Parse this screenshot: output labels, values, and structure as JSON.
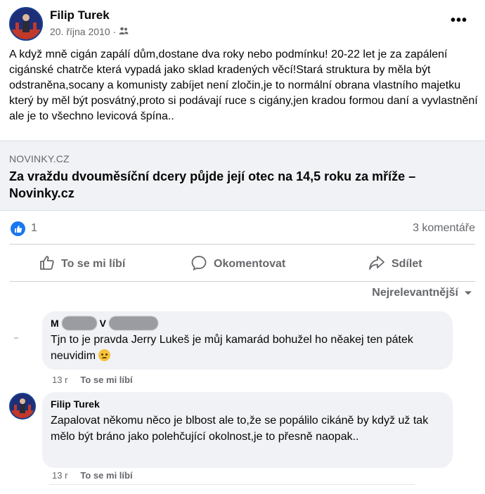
{
  "post": {
    "author": "Filip Turek",
    "date": "20. října 2010",
    "separator": "·",
    "audience_icon": "friends-icon",
    "more_icon": "more-options-icon",
    "more_glyph": "•••",
    "text": "A když mně cigán zapálí dům,dostane dva roky nebo podmínku! 20-22 let je za zapálení cigánské chatrče která vypadá jako sklad kradených věcí!Stará struktura by měla být odstraněna,socany a komunisty zabíjet není zločin,je to normální obrana vlastního majetku který by měl být posvátný,proto si podávají ruce s cigány,jen kradou formou daní a vyvlastnění ale je to všechno levicová špína.."
  },
  "link_card": {
    "domain": "NOVINKY.CZ",
    "title": "Za vraždu dvouměsíční dcery půjde její otec na 14,5 roku za mříže – Novinky.cz"
  },
  "stats": {
    "likes": "1",
    "comments": "3 komentáře"
  },
  "actions": {
    "like": "To se mi líbí",
    "comment": "Okomentovat",
    "share": "Sdílet"
  },
  "sort": {
    "label": "Nejrelevantnější"
  },
  "comments": [
    {
      "name_initial_1": "M",
      "name_initial_2": "V",
      "text": "Tjn to je pravda Jerry Lukeš je můj kamarád bohužel ho něakej ten pátek neuvidim",
      "emoji": "sad-face-emoji",
      "time": "13 r",
      "like": "To se mi líbí"
    },
    {
      "name": "Filip Turek",
      "text": "Zapalovat někomu něco je blbost ale to,že se popálilo cikáně by když už tak mělo být bráno jako polehčující okolnost,je to přesně naopak..",
      "time": "13 r",
      "like": "To se mi líbí"
    }
  ],
  "colors": {
    "accent": "#1877f2",
    "muted": "#65676b",
    "card_bg": "#f0f2f5"
  }
}
